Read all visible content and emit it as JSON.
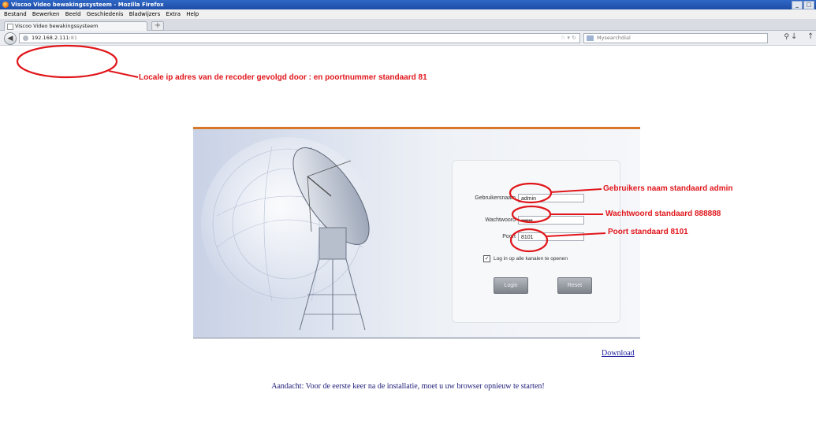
{
  "browser": {
    "window_title": "Viscoo Video bewakingssysteem - Mozilla Firefox",
    "menu": [
      "Bestand",
      "Bewerken",
      "Beeld",
      "Geschiedenis",
      "Bladwijzers",
      "Extra",
      "Help"
    ],
    "tab_label": "Viscoo Video bewakingssysteem",
    "new_tab": "+",
    "url_host": "192.168.2.111:",
    "url_port": "81",
    "search_placeholder": "Mysearchdial",
    "window_buttons": [
      "_",
      "□",
      "x"
    ]
  },
  "annotations": {
    "url_note": "Locale ip adres van de recoder gevolgd door : en poortnummer standaard 81",
    "user_note": "Gebruikers naam standaard admin",
    "password_note": "Wachtwoord standaard 888888",
    "port_note": "Poort standaard 8101",
    "color": "#e0161b"
  },
  "login": {
    "username_label": "Gebruikersnaam",
    "username_value": "admin",
    "password_label": "Wachtwoord",
    "password_value": "••••••",
    "port_label": "Poort",
    "port_value": "8101",
    "checkbox_label": "Log in op alle kanalen te openen",
    "checkbox_checked": true,
    "login_button": "Login",
    "reset_button": "Reset"
  },
  "page": {
    "download_link": "Download",
    "notice": "Aandacht: Voor de eerste keer na de installatie, moet u uw browser opnieuw te starten!"
  }
}
